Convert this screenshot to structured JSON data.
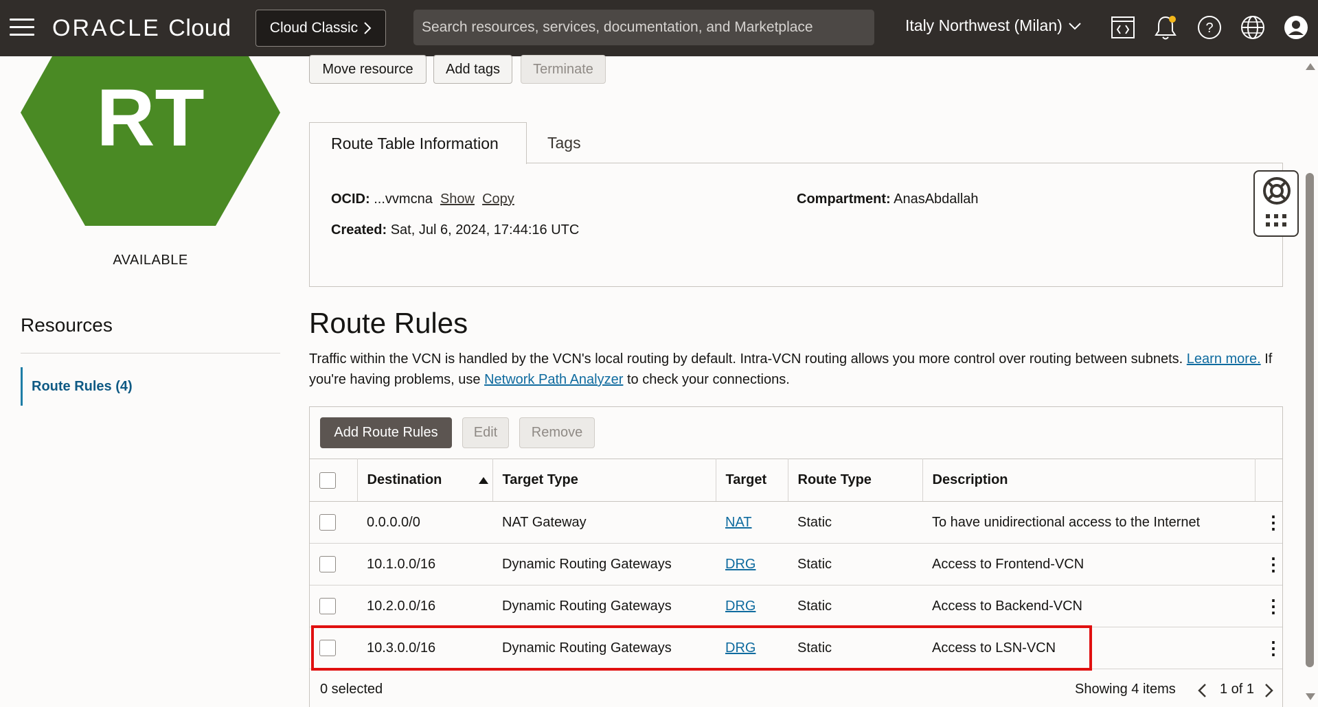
{
  "header": {
    "brand_oracle": "ORACLE",
    "brand_cloud": "Cloud",
    "classic_label": "Cloud Classic",
    "search_placeholder": "Search resources, services, documentation, and Marketplace",
    "region": "Italy Northwest (Milan)"
  },
  "resource": {
    "badge": "RT",
    "badge_color": "#4a8a24",
    "status": "AVAILABLE"
  },
  "actions": {
    "move": "Move resource",
    "tags": "Add tags",
    "terminate": "Terminate"
  },
  "tabs": {
    "info": "Route Table Information",
    "tags": "Tags"
  },
  "info": {
    "ocid_label": "OCID:",
    "ocid_value": "...vvmcna",
    "show": "Show",
    "copy": "Copy",
    "created_label": "Created:",
    "created_value": "Sat, Jul 6, 2024, 17:44:16 UTC",
    "compartment_label": "Compartment:",
    "compartment_value": "AnasAbdallah"
  },
  "sidebar": {
    "title": "Resources",
    "items": [
      {
        "label": "Route Rules (4)"
      }
    ]
  },
  "section": {
    "title": "Route Rules",
    "desc_part1": "Traffic within the VCN is handled by the VCN's local routing by default. Intra-VCN routing allows you more control over routing between subnets.",
    "learn_more": "Learn more.",
    "desc_part2": "If you're having problems, use",
    "analyzer": "Network Path Analyzer",
    "desc_part3": "to check your connections."
  },
  "table": {
    "buttons": {
      "add": "Add Route Rules",
      "edit": "Edit",
      "remove": "Remove"
    },
    "columns": [
      "Destination",
      "Target Type",
      "Target",
      "Route Type",
      "Description"
    ],
    "rows": [
      {
        "destination": "0.0.0.0/0",
        "target_type": "NAT Gateway",
        "target": "NAT",
        "route_type": "Static",
        "description": "To have unidirectional access to the Internet"
      },
      {
        "destination": "10.1.0.0/16",
        "target_type": "Dynamic Routing Gateways",
        "target": "DRG",
        "route_type": "Static",
        "description": "Access to Frontend-VCN"
      },
      {
        "destination": "10.2.0.0/16",
        "target_type": "Dynamic Routing Gateways",
        "target": "DRG",
        "route_type": "Static",
        "description": "Access to Backend-VCN"
      },
      {
        "destination": "10.3.0.0/16",
        "target_type": "Dynamic Routing Gateways",
        "target": "DRG",
        "route_type": "Static",
        "description": "Access to LSN-VCN"
      }
    ],
    "selected": "0 selected",
    "showing": "Showing 4 items",
    "page": "1 of 1"
  },
  "icons": [
    "menu-icon",
    "chevron-right-icon",
    "chevron-down-icon",
    "code-editor-icon",
    "bell-icon",
    "help-icon",
    "globe-icon",
    "user-icon",
    "lifebuoy-icon",
    "grid-icon",
    "sort-asc-icon",
    "kebab-icon",
    "chevron-left-icon"
  ]
}
